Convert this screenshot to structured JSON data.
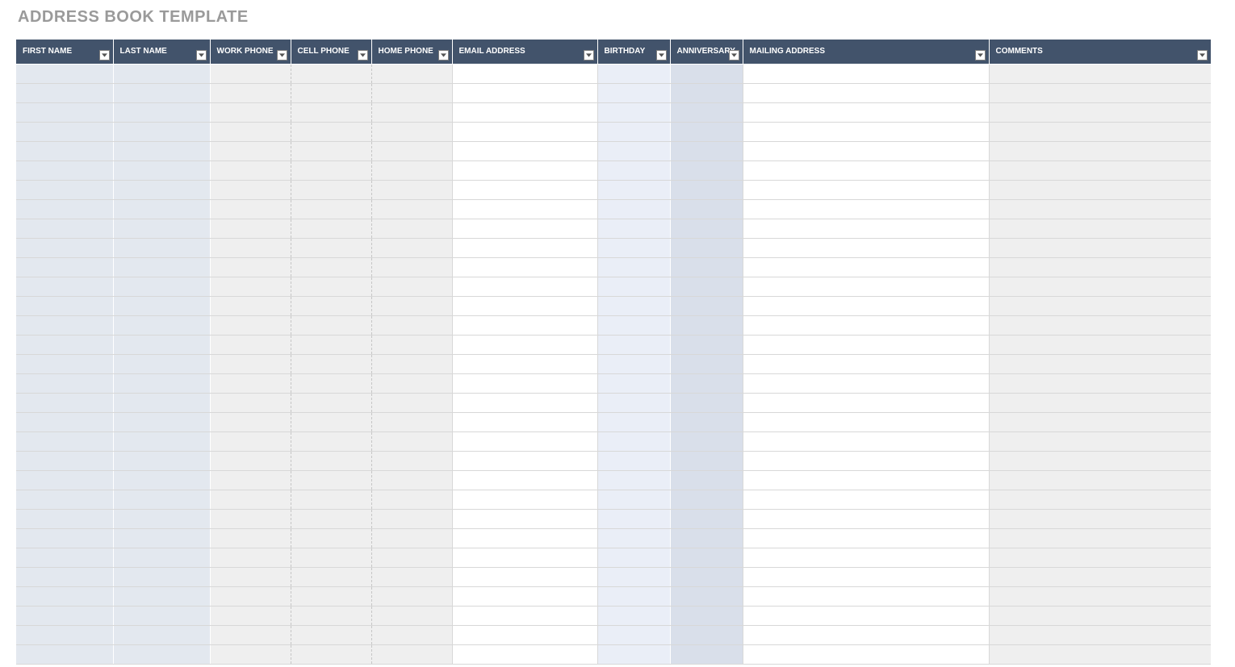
{
  "title": "ADDRESS BOOK TEMPLATE",
  "columns": [
    {
      "key": "first_name",
      "label": "FIRST NAME"
    },
    {
      "key": "last_name",
      "label": "LAST NAME"
    },
    {
      "key": "work_phone",
      "label": "WORK PHONE"
    },
    {
      "key": "cell_phone",
      "label": "CELL PHONE"
    },
    {
      "key": "home_phone",
      "label": "HOME PHONE"
    },
    {
      "key": "email",
      "label": "EMAIL ADDRESS"
    },
    {
      "key": "birthday",
      "label": "BIRTHDAY"
    },
    {
      "key": "anniversary",
      "label": "ANNIVERSARY"
    },
    {
      "key": "mailing",
      "label": "MAILING ADDRESS"
    },
    {
      "key": "comments",
      "label": "COMMENTS"
    }
  ],
  "row_count": 31,
  "rows": []
}
